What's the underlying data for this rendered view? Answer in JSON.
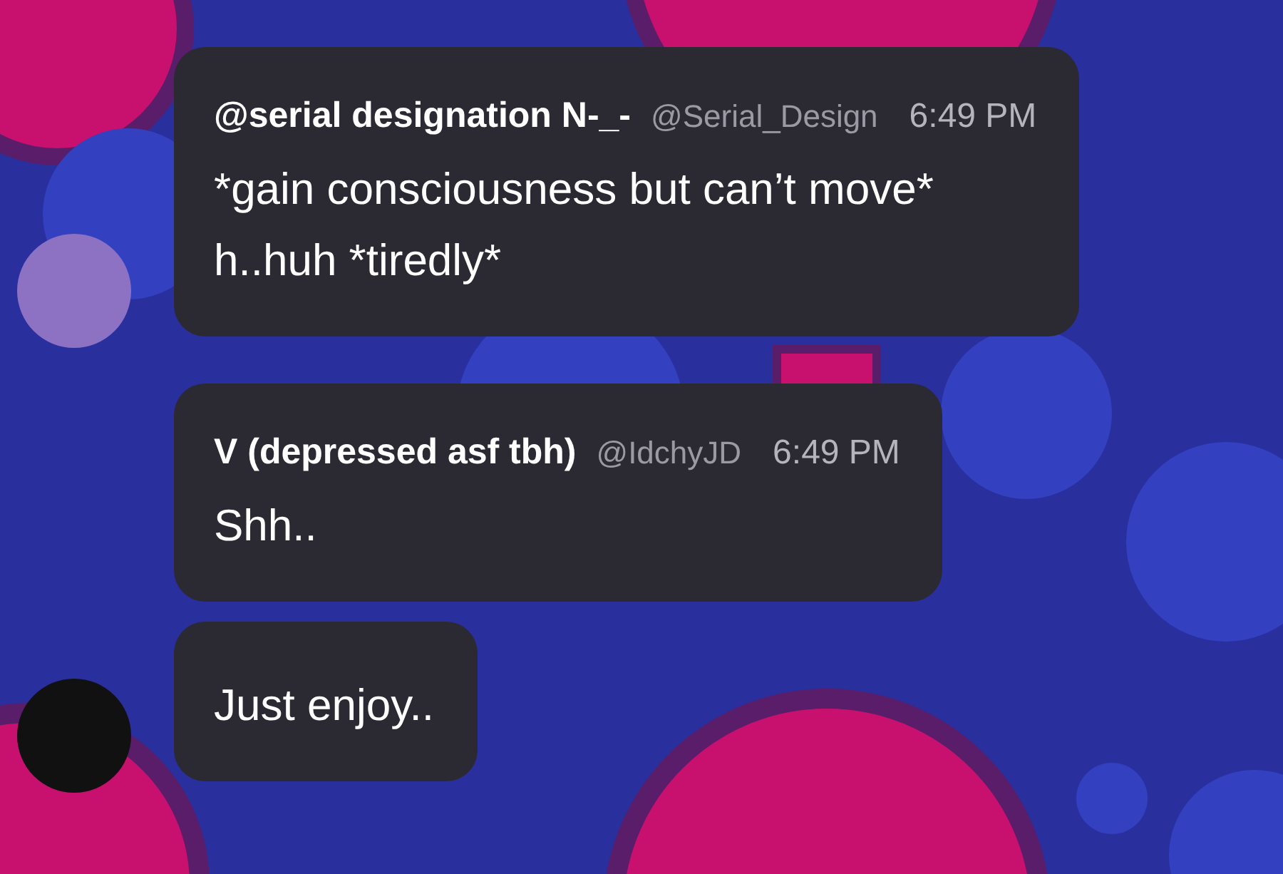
{
  "groups": [
    {
      "messages": [
        {
          "author": "@serial designation N-_-",
          "handle": "@Serial_Design",
          "time": "6:49 PM",
          "lines": [
            "*gain consciousness but can’t move*",
            "h..huh *tiredly*"
          ]
        }
      ]
    },
    {
      "messages": [
        {
          "author": "V (depressed asf tbh)",
          "handle": "@IdchyJD",
          "time": "6:49 PM",
          "lines": [
            "Shh.."
          ]
        },
        {
          "lines": [
            "Just enjoy.."
          ]
        }
      ]
    }
  ]
}
